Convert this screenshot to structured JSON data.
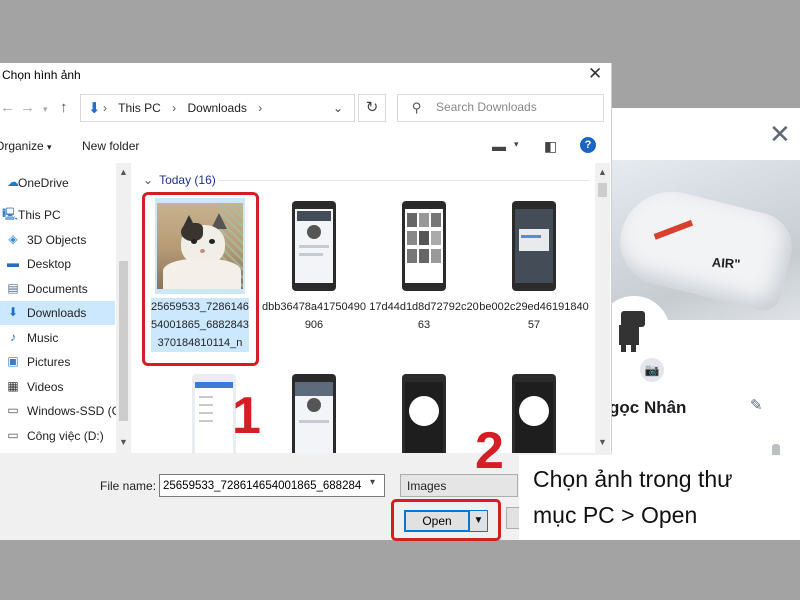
{
  "dialog": {
    "title": "Chọn hình ảnh",
    "breadcrumb": [
      "This PC",
      "Downloads"
    ],
    "search_placeholder": "Search Downloads",
    "commands": {
      "organize": "Organize",
      "new_folder": "New folder"
    }
  },
  "sidebar": {
    "items": [
      {
        "label": "OneDrive",
        "icon": "cloud-icon"
      },
      {
        "label": "This PC",
        "icon": "computer-icon"
      },
      {
        "label": "3D Objects",
        "icon": "cube-icon"
      },
      {
        "label": "Desktop",
        "icon": "desktop-icon"
      },
      {
        "label": "Documents",
        "icon": "document-icon"
      },
      {
        "label": "Downloads",
        "icon": "download-icon",
        "selected": true
      },
      {
        "label": "Music",
        "icon": "music-icon"
      },
      {
        "label": "Pictures",
        "icon": "pictures-icon"
      },
      {
        "label": "Videos",
        "icon": "video-icon"
      },
      {
        "label": "Windows-SSD (C",
        "icon": "drive-icon"
      },
      {
        "label": "Công việc (D:)",
        "icon": "drive-icon"
      }
    ]
  },
  "files": {
    "group": "Today (16)",
    "items": [
      {
        "name": "25659533_728614654001865_6882843370184810114_n",
        "selected": true
      },
      {
        "name": "dbb36478a41750490906"
      },
      {
        "name": "17d44d1d8d72792c2063"
      },
      {
        "name": "be002c29ed4619184057"
      }
    ]
  },
  "bottom": {
    "file_name_label": "File name:",
    "file_name_value": "25659533_728614654001865_688284",
    "file_type": "Images",
    "open_label": "Open"
  },
  "background_page": {
    "profile_name": "gọc Nhân",
    "cover_text": "AIR\""
  },
  "annotations": {
    "step1": "1",
    "step2": "2",
    "caption_line1": "Chọn ảnh trong thư",
    "caption_line2": "mục PC > Open",
    "accent_color": "#d41e25"
  }
}
